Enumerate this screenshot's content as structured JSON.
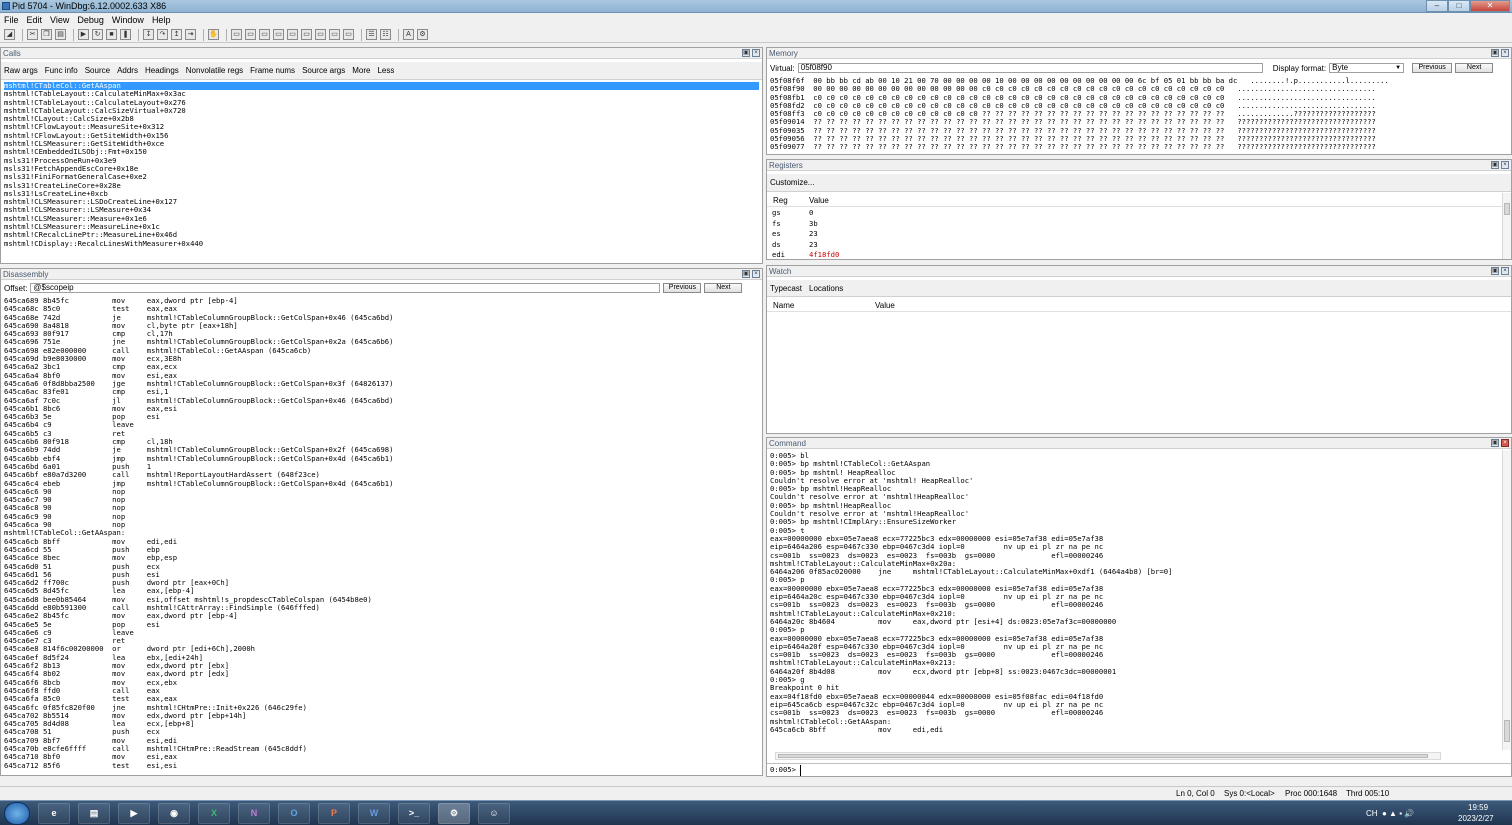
{
  "window": {
    "title": "Pid 5704 - WinDbg:6.12.0002.633 X86"
  },
  "menu": [
    "File",
    "Edit",
    "View",
    "Debug",
    "Window",
    "Help"
  ],
  "calls": {
    "title": "Calls",
    "options": [
      "Raw args",
      "Func info",
      "Source",
      "Addrs",
      "Headings",
      "Nonvolatile regs",
      "Frame nums",
      "Source args",
      "More",
      "Less"
    ],
    "frames": [
      "mshtml!CTableCol::GetAAspan",
      "mshtml!CTableLayout::CalculateMinMax+0x3ac",
      "mshtml!CTableLayout::CalculateLayout+0x276",
      "mshtml!CTableLayout::CalcSizeVirtual+0x720",
      "mshtml!CLayout::CalcSize+0x2b8",
      "mshtml!CFlowLayout::MeasureSite+0x312",
      "mshtml!CFlowLayout::GetSiteWidth+0x156",
      "mshtml!CLSMeasurer::GetSiteWidth+0xce",
      "mshtml!CEmbeddedILSObj::Fmt+0x150",
      "msls31!ProcessOneRun+0x3e9",
      "msls31!FetchAppendEscCore+0x18e",
      "msls31!FiniFormatGeneralCase+0xe2",
      "msls31!CreateLineCore+0x28e",
      "msls31!LsCreateLine+0xcb",
      "mshtml!CLSMeasurer::LSDoCreateLine+0x127",
      "mshtml!CLSMeasurer::LSMeasure+0x34",
      "mshtml!CLSMeasurer::Measure+0x1e6",
      "mshtml!CLSMeasurer::MeasureLine+0x1c",
      "mshtml!CRecalcLinePtr::MeasureLine+0x46d",
      "mshtml!CDisplay::RecalcLinesWithMeasurer+0x440"
    ]
  },
  "memory": {
    "title": "Memory",
    "virtual_label": "Virtual:",
    "virtual_value": "05f08f90",
    "format_label": "Display format:",
    "format_value": "Byte",
    "prev_label": "Previous",
    "next_label": "Next",
    "rows": [
      "05f08f6f  00 bb bb cd ab 00 10 21 00 70 00 00 00 00 10 00 00 00 00 00 00 00 00 00 00 6c bf 05 01 bb bb ba dc   ........!.p...........l.........",
      "05f08f90  00 00 00 00 00 00 00 00 00 00 00 00 00 c0 c0 c0 c0 c0 c0 c0 c0 c0 c0 c0 c0 c0 c0 c0 c0 c0 c0 c0   ................................",
      "05f08fb1  c0 c0 c0 c0 c0 c0 c0 c0 c0 c0 c0 c0 c0 c0 c0 c0 c0 c0 c0 c0 c0 c0 c0 c0 c0 c0 c0 c0 c0 c0 c0 c0   ................................",
      "05f08fd2  c0 c0 c0 c0 c0 c0 c0 c0 c0 c0 c0 c0 c0 c0 c0 c0 c0 c0 c0 c0 c0 c0 c0 c0 c0 c0 c0 c0 c0 c0 c0 c0   ................................",
      "05f08ff3  c0 c0 c0 c0 c0 c0 c0 c0 c0 c0 c0 c0 c0 ?? ?? ?? ?? ?? ?? ?? ?? ?? ?? ?? ?? ?? ?? ?? ?? ?? ?? ??   .............???????????????????",
      "05f09014  ?? ?? ?? ?? ?? ?? ?? ?? ?? ?? ?? ?? ?? ?? ?? ?? ?? ?? ?? ?? ?? ?? ?? ?? ?? ?? ?? ?? ?? ?? ?? ??   ????????????????????????????????",
      "05f09035  ?? ?? ?? ?? ?? ?? ?? ?? ?? ?? ?? ?? ?? ?? ?? ?? ?? ?? ?? ?? ?? ?? ?? ?? ?? ?? ?? ?? ?? ?? ?? ??   ????????????????????????????????",
      "05f09056  ?? ?? ?? ?? ?? ?? ?? ?? ?? ?? ?? ?? ?? ?? ?? ?? ?? ?? ?? ?? ?? ?? ?? ?? ?? ?? ?? ?? ?? ?? ?? ??   ????????????????????????????????",
      "05f09077  ?? ?? ?? ?? ?? ?? ?? ?? ?? ?? ?? ?? ?? ?? ?? ?? ?? ?? ?? ?? ?? ?? ?? ?? ?? ?? ?? ?? ?? ?? ?? ??   ????????????????????????????????"
    ]
  },
  "registers": {
    "title": "Registers",
    "customize": "Customize...",
    "col_reg": "Reg",
    "col_value": "Value",
    "rows": [
      {
        "reg": "gs",
        "value": "0"
      },
      {
        "reg": "fs",
        "value": "3b"
      },
      {
        "reg": "es",
        "value": "23"
      },
      {
        "reg": "ds",
        "value": "23"
      },
      {
        "reg": "edi",
        "value": "4f18fd0"
      }
    ],
    "changed_color": "#d00000"
  },
  "watch": {
    "title": "Watch",
    "tabs": [
      "Typecast",
      "Locations"
    ],
    "col_name": "Name",
    "col_value": "Value"
  },
  "disassembly": {
    "title": "Disassembly",
    "offset_label": "Offset:",
    "offset_value": "@$scopeip",
    "prev_label": "Previous",
    "next_label": "Next",
    "lines": [
      "645ca689 8b45fc          mov     eax,dword ptr [ebp-4]",
      "645ca68c 85c0            test    eax,eax",
      "645ca68e 742d            je      mshtml!CTableColumnGroupBlock::GetColSpan+0x46 (645ca6bd)",
      "645ca690 8a4818          mov     cl,byte ptr [eax+18h]",
      "645ca693 80f917          cmp     cl,17h",
      "645ca696 751e            jne     mshtml!CTableColumnGroupBlock::GetColSpan+0x2a (645ca6b6)",
      "645ca698 e82e000000      call    mshtml!CTableCol::GetAAspan (645ca6cb)",
      "645ca69d b9e8030000      mov     ecx,3E8h",
      "645ca6a2 3bc1            cmp     eax,ecx",
      "645ca6a4 8bf0            mov     esi,eax",
      "645ca6a6 0f8d8bba2500    jge     mshtml!CTableColumnGroupBlock::GetColSpan+0x3f (64826137)",
      "645ca6ac 83fe01          cmp     esi,1",
      "645ca6af 7c0c            jl      mshtml!CTableColumnGroupBlock::GetColSpan+0x46 (645ca6bd)",
      "645ca6b1 8bc6            mov     eax,esi",
      "645ca6b3 5e              pop     esi",
      "645ca6b4 c9              leave",
      "645ca6b5 c3              ret",
      "645ca6b6 80f918          cmp     cl,18h",
      "645ca6b9 74dd            je      mshtml!CTableColumnGroupBlock::GetColSpan+0x2f (645ca698)",
      "645ca6bb ebf4            jmp     mshtml!CTableColumnGroupBlock::GetColSpan+0x4d (645ca6b1)",
      "645ca6bd 6a01            push    1",
      "645ca6bf e80a7d3200      call    mshtml!ReportLayoutHardAssert (648f23ce)",
      "645ca6c4 ebeb            jmp     mshtml!CTableColumnGroupBlock::GetColSpan+0x4d (645ca6b1)",
      "645ca6c6 90              nop",
      "645ca6c7 90              nop",
      "645ca6c8 90              nop",
      "645ca6c9 90              nop",
      "645ca6ca 90              nop",
      "mshtml!CTableCol::GetAAspan:",
      "645ca6cb 8bff            mov     edi,edi",
      "645ca6cd 55              push    ebp",
      "645ca6ce 8bec            mov     ebp,esp",
      "645ca6d0 51              push    ecx",
      "645ca6d1 56              push    esi",
      "645ca6d2 ff700c          push    dword ptr [eax+0Ch]",
      "645ca6d5 8d45fc          lea     eax,[ebp-4]",
      "645ca6d8 bee0b85464      mov     esi,offset mshtml!s_propdescCTableColspan (6454b8e0)",
      "645ca6dd e80b591300      call    mshtml!CAttrArray::FindSimple (646fffed)",
      "645ca6e2 8b45fc          mov     eax,dword ptr [ebp-4]",
      "645ca6e5 5e              pop     esi",
      "645ca6e6 c9              leave",
      "645ca6e7 c3              ret",
      "645ca6e8 814f6c00200000  or      dword ptr [edi+6Ch],2000h",
      "645ca6ef 8d5f24          lea     ebx,[edi+24h]",
      "645ca6f2 8b13            mov     edx,dword ptr [ebx]",
      "645ca6f4 8b02            mov     eax,dword ptr [edx]",
      "645ca6f6 8bcb            mov     ecx,ebx",
      "645ca6f8 ffd0            call    eax",
      "645ca6fa 85c0            test    eax,eax",
      "645ca6fc 0f85fc820f00    jne     mshtml!CHtmPre::Init+0x226 (646c29fe)",
      "645ca702 8b5514          mov     edx,dword ptr [ebp+14h]",
      "645ca705 8d4d08          lea     ecx,[ebp+8]",
      "645ca708 51              push    ecx",
      "645ca709 8bf7            mov     esi,edi",
      "645ca70b e8cfe6ffff      call    mshtml!CHtmPre::ReadStream (645c8ddf)",
      "645ca710 8bf0            mov     esi,eax",
      "645ca712 85f6            test    esi,esi"
    ]
  },
  "command": {
    "title": "Command",
    "prompt": "0:005>",
    "lines": [
      "0:005> bl",
      "0:005> bp mshtml!CTableCol::GetAAspan",
      "0:005> bp mshtml! HeapRealloc",
      "Couldn't resolve error at 'mshtml! HeapRealloc'",
      "0:005> bp mshtml!HeapRealloc",
      "Couldn't resolve error at 'mshtml!HeapRealloc'",
      "0:005> bp mshtml!HeapRealloc",
      "Couldn't resolve error at 'mshtml!HeapRealloc'",
      "0:005> bp mshtml!CImplAry::EnsureSizeWorker",
      "0:005> t",
      "eax=00000000 ebx=05e7aea8 ecx=77225bc3 edx=00000000 esi=05e7af38 edi=05e7af38",
      "eip=6464a206 esp=0467c330 ebp=0467c3d4 iopl=0         nv up ei pl zr na pe nc",
      "cs=001b  ss=0023  ds=0023  es=0023  fs=003b  gs=0000             efl=00000246",
      "mshtml!CTableLayout::CalculateMinMax+0x20a:",
      "6464a206 0f85ac020000    jne     mshtml!CTableLayout::CalculateMinMax+0xdf1 (6464a4b8) [br=0]",
      "0:005> p",
      "eax=00000000 ebx=05e7aea8 ecx=77225bc3 edx=00000000 esi=05e7af38 edi=05e7af38",
      "eip=6464a20c esp=0467c330 ebp=0467c3d4 iopl=0         nv up ei pl zr na pe nc",
      "cs=001b  ss=0023  ds=0023  es=0023  fs=003b  gs=0000             efl=00000246",
      "mshtml!CTableLayout::CalculateMinMax+0x210:",
      "6464a20c 8b4604          mov     eax,dword ptr [esi+4] ds:0023:05e7af3c=00000000",
      "0:005> p",
      "eax=00000000 ebx=05e7aea8 ecx=77225bc3 edx=00000000 esi=05e7af38 edi=05e7af38",
      "eip=6464a20f esp=0467c330 ebp=0467c3d4 iopl=0         nv up ei pl zr na pe nc",
      "cs=001b  ss=0023  ds=0023  es=0023  fs=003b  gs=0000             efl=00000246",
      "mshtml!CTableLayout::CalculateMinMax+0x213:",
      "6464a20f 8b4d08          mov     ecx,dword ptr [ebp+8] ss:0023:0467c3dc=00000001",
      "0:005> g",
      "Breakpoint 0 hit",
      "eax=04f18fd0 ebx=05e7aea8 ecx=00000044 edx=00000000 esi=05f08fac edi=04f18fd0",
      "eip=645ca6cb esp=0467c32c ebp=0467c3d4 iopl=0         nv up ei pl zr na pe nc",
      "cs=001b  ss=0023  ds=0023  es=0023  fs=003b  gs=0000             efl=00000246",
      "mshtml!CTableCol::GetAAspan:",
      "645ca6cb 8bff            mov     edi,edi"
    ]
  },
  "status": {
    "pos": "Ln 0, Col 0",
    "sys": "Sys 0:<Local>",
    "proc": "Proc 000:1648",
    "thrd": "Thrd 005:10"
  },
  "taskbar": {
    "apps": [
      "ie",
      "folder",
      "media",
      "chrome",
      "excel",
      "onenote",
      "outlook",
      "powerpoint",
      "word",
      "cmd",
      "windbg",
      "photo"
    ],
    "clock_time": "19:59",
    "clock_date": "2023/2/27",
    "tray_text": "CH"
  }
}
